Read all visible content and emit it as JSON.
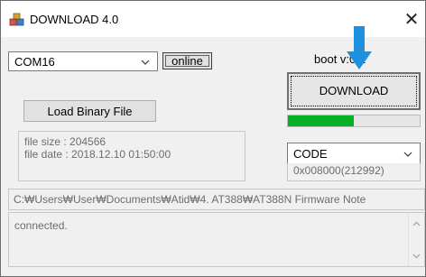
{
  "window": {
    "title": "DOWNLOAD 4.0",
    "close_glyph": "✕"
  },
  "port": {
    "selected": "COM16",
    "status_label": "online"
  },
  "boot_version": "boot  v:0.2",
  "download_label": "DOWNLOAD",
  "progress_percent": 50,
  "load_button_label": "Load Binary File",
  "file_info": {
    "size_line": "file size : 204566",
    "date_line": "file date : 2018.12.10 01:50:00"
  },
  "region": {
    "selected": "CODE",
    "address": "0x008000(212992)"
  },
  "file_path": "C:₩Users₩User₩Documents₩Atid₩4. AT388₩AT388N Firmware Note",
  "log_text": "connected.",
  "colors": {
    "progress": "#06b025",
    "arrow": "#1e90e0",
    "focus": "#0078d7"
  }
}
